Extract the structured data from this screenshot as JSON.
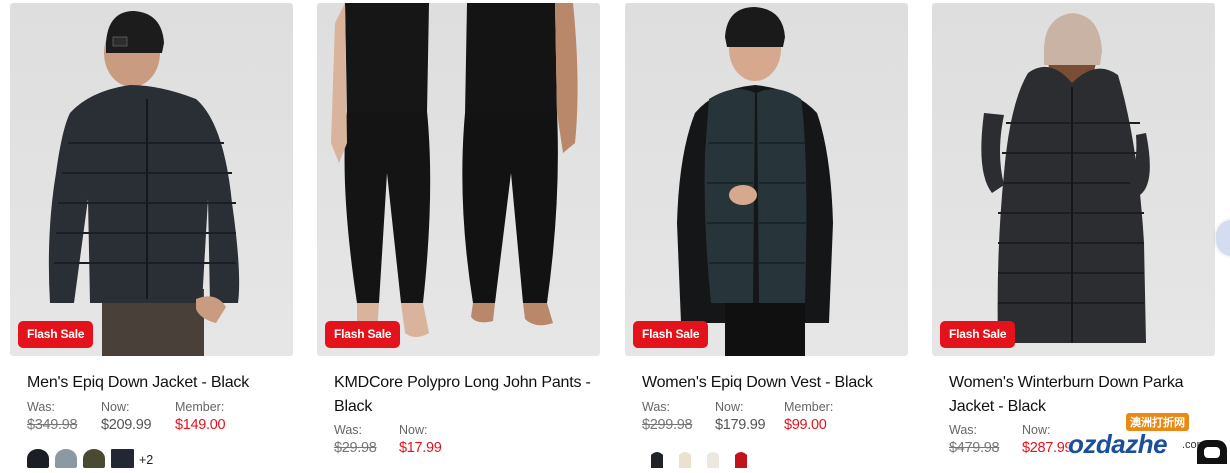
{
  "products": [
    {
      "name": "Men's Epiq Down Jacket - Black",
      "badge": "Flash Sale",
      "was_label": "Was:",
      "was": "$349.98",
      "now_label": "Now:",
      "now": "$209.99",
      "member_label": "Member:",
      "member": "$149.00",
      "swatch_colors": [
        "#1b1e24",
        "#8c98a2",
        "#4a4a32",
        "#232733"
      ],
      "more_swatches": "+2",
      "image_icon": "man-in-puffer-jacket-photo"
    },
    {
      "name": "KMDCore Polypro Long John Pants - Black",
      "badge": "Flash Sale",
      "was_label": "Was:",
      "was": "$29.98",
      "now_label": "Now:",
      "now": "$17.99",
      "image_icon": "models-in-thermal-pants-photo"
    },
    {
      "name": "Women's Epiq Down Vest - Black",
      "badge": "Flash Sale",
      "was_label": "Was:",
      "was": "$299.98",
      "now_label": "Now:",
      "now": "$179.99",
      "member_label": "Member:",
      "member": "$99.00",
      "swatch_colors": [
        "#1f2328",
        "#e9e2cf",
        "#ece8df",
        "#c2121d"
      ],
      "image_icon": "woman-in-down-vest-photo"
    },
    {
      "name": "Women's Winterburn Down Parka Jacket - Black",
      "badge": "Flash Sale",
      "was_label": "Was:",
      "was": "$479.98",
      "now_label": "Now:",
      "now": "$287.99",
      "image_icon": "woman-in-long-parka-photo"
    }
  ],
  "watermark": {
    "badge": "澳洲打折网",
    "text": "ozdazhe",
    "suffix": ".com"
  },
  "colors": {
    "sale_red": "#e4131b",
    "image_bg": "#e2e2e2"
  },
  "icons": {
    "chat": "chat-bubble-icon",
    "side_tab": "side-panel-tab-icon"
  }
}
